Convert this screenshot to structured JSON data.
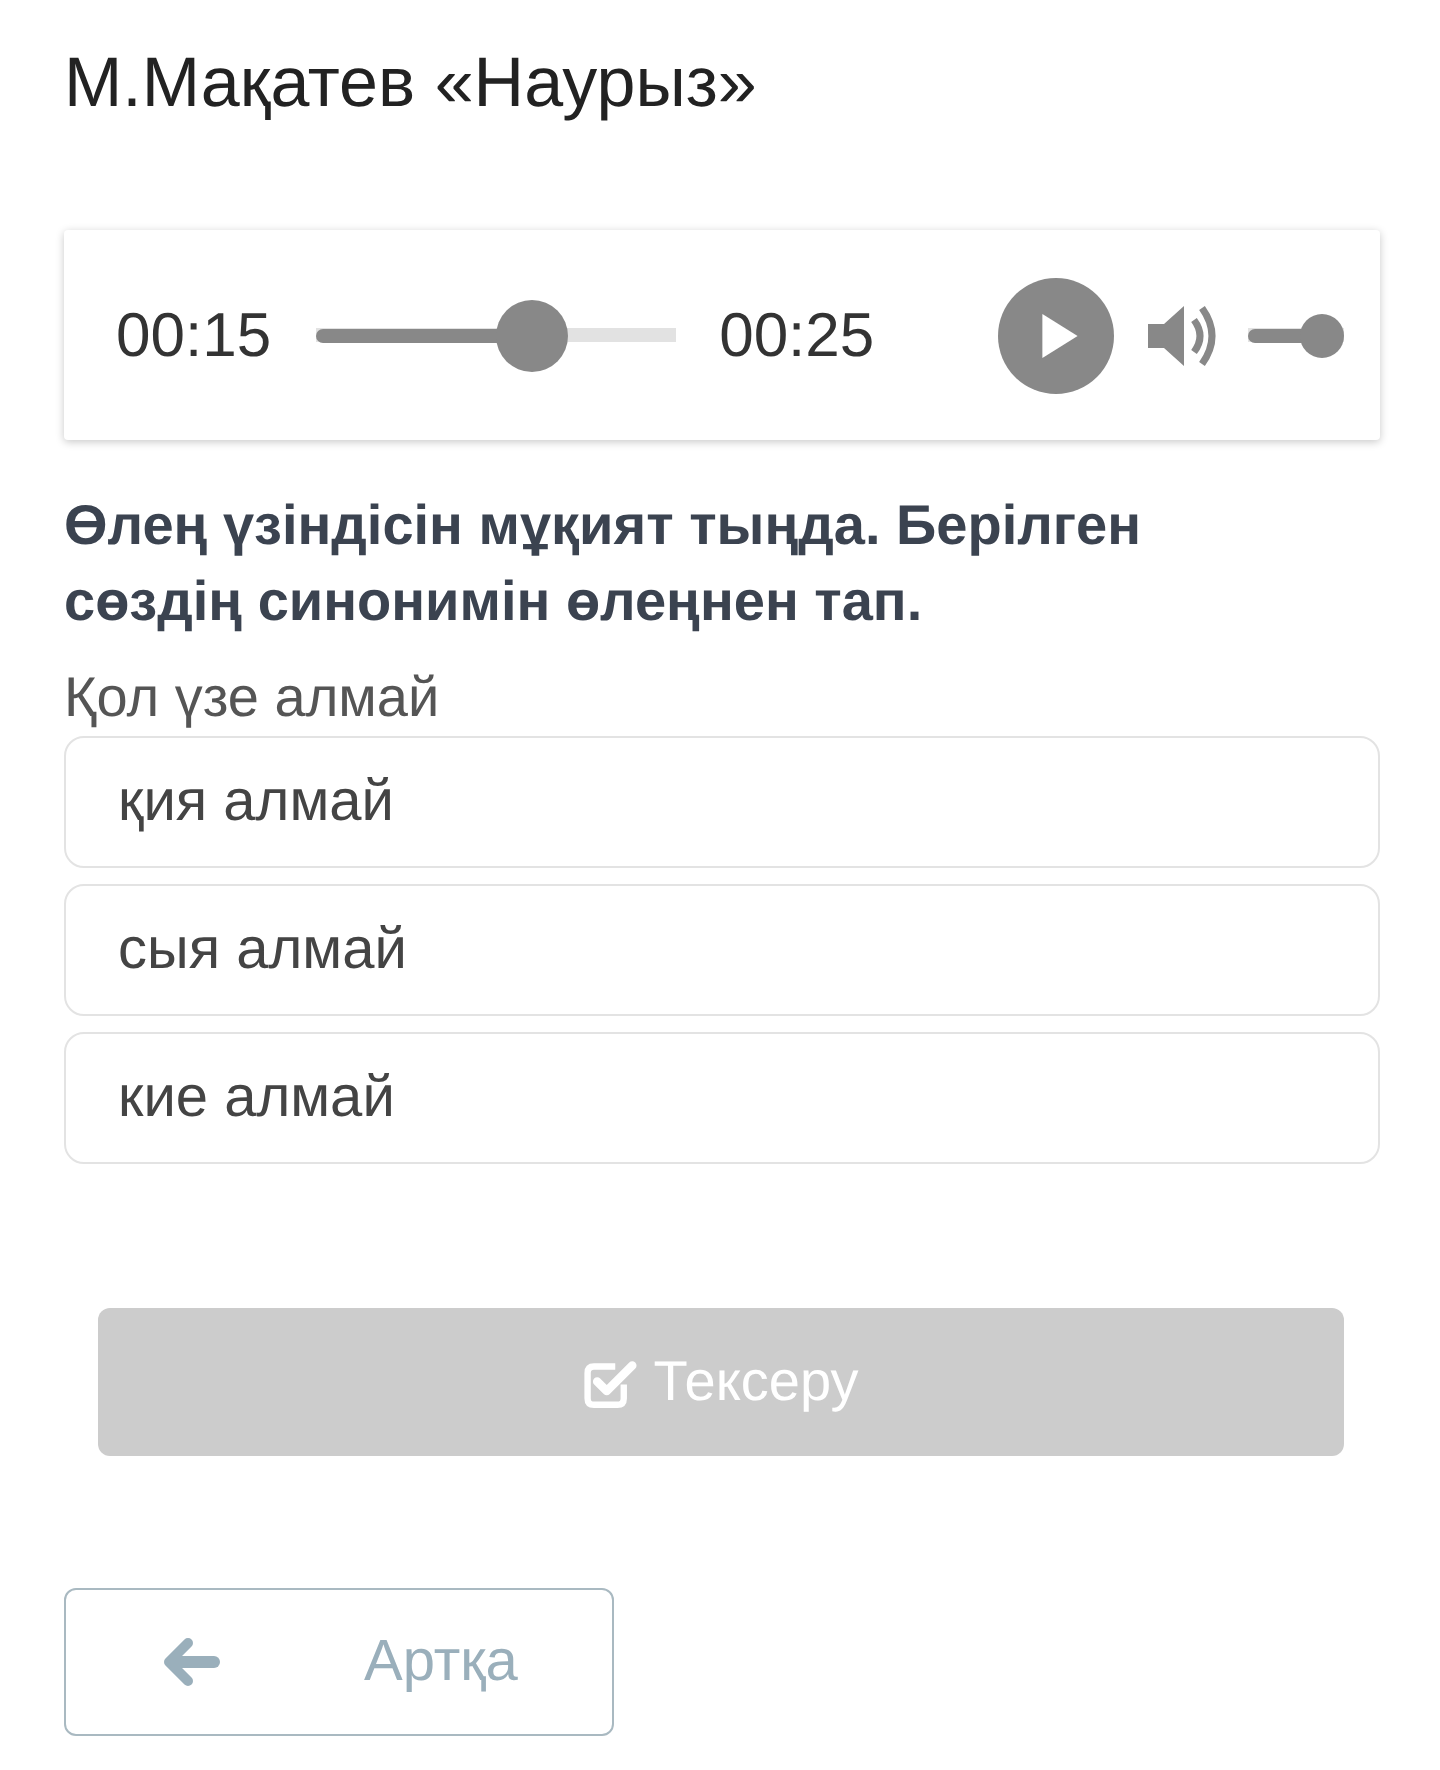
{
  "title": "М.Мақатев «Наурыз»",
  "player": {
    "current_time": "00:15",
    "progress": {
      "level": 0.6
    },
    "duration": "00:25",
    "playing": false,
    "volume": {
      "level": 0.77
    }
  },
  "question": "Өлең үзіндісін мұқият тыңда. Берілген сөздің синонимін өлеңнен тап.",
  "word": "Қол үзе алмай",
  "options": [
    {
      "label": "қия алмай",
      "selected": false
    },
    {
      "label": "сыя алмай",
      "selected": false
    },
    {
      "label": "кие алмай",
      "selected": false
    }
  ],
  "check_button": {
    "label": "Тексеру",
    "disabled": true
  },
  "back_button": {
    "label": "Артқа"
  }
}
